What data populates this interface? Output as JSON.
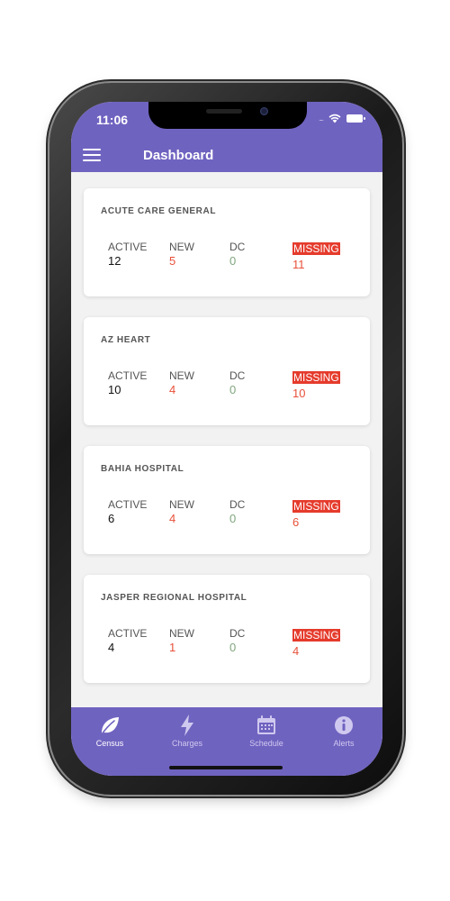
{
  "status_bar": {
    "time": "11:06",
    "signal": "....",
    "icons": [
      "wifi-icon",
      "battery-icon"
    ]
  },
  "header": {
    "title": "Dashboard",
    "menu_icon": "hamburger-menu-icon"
  },
  "colors": {
    "brand": "#6f63c0",
    "missing_badge": "#e53b2c",
    "new_value": "#e8503a",
    "dc_value": "#7fa67d"
  },
  "cards": [
    {
      "title": "ACUTE CARE GENERAL",
      "active_label": "ACTIVE",
      "active": "12",
      "new_label": "NEW",
      "new": "5",
      "dc_label": "DC",
      "dc": "0",
      "missing_label": "MISSING",
      "missing": "11"
    },
    {
      "title": "AZ HEART",
      "active_label": "ACTIVE",
      "active": "10",
      "new_label": "NEW",
      "new": "4",
      "dc_label": "DC",
      "dc": "0",
      "missing_label": "MISSING",
      "missing": "10"
    },
    {
      "title": "BAHIA HOSPITAL",
      "active_label": "ACTIVE",
      "active": "6",
      "new_label": "NEW",
      "new": "4",
      "dc_label": "DC",
      "dc": "0",
      "missing_label": "MISSING",
      "missing": "6"
    },
    {
      "title": "JASPER REGIONAL HOSPITAL",
      "active_label": "ACTIVE",
      "active": "4",
      "new_label": "NEW",
      "new": "1",
      "dc_label": "DC",
      "dc": "0",
      "missing_label": "MISSING",
      "missing": "4"
    }
  ],
  "tabs": [
    {
      "label": "Census",
      "icon": "leaf-icon",
      "active": true
    },
    {
      "label": "Charges",
      "icon": "lightning-bolt-icon",
      "active": false
    },
    {
      "label": "Schedule",
      "icon": "calendar-icon",
      "active": false
    },
    {
      "label": "Alerts",
      "icon": "info-circle-icon",
      "active": false
    }
  ]
}
